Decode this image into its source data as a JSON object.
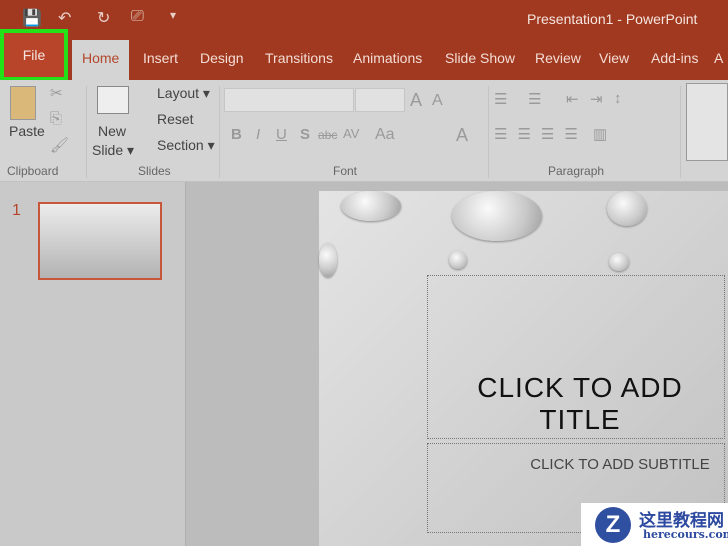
{
  "window": {
    "title": "Presentation1  -  PowerPoint"
  },
  "qat": {
    "save": "💾",
    "undo": "↶",
    "redo": "↻",
    "present": "⎚",
    "customize": "▾"
  },
  "tabs": [
    "File",
    "Home",
    "Insert",
    "Design",
    "Transitions",
    "Animations",
    "Slide Show",
    "Review",
    "View",
    "Add-ins",
    "A"
  ],
  "ribbon": {
    "clipboard": {
      "paste": "Paste",
      "label": "Clipboard"
    },
    "slides": {
      "new_slide": "New",
      "new_slide2": "Slide ▾",
      "layout": "Layout ▾",
      "reset": "Reset",
      "section": "Section ▾",
      "label": "Slides"
    },
    "font": {
      "bold": "B",
      "italic": "I",
      "underline": "U",
      "strike": "S",
      "abc": "abc",
      "spacing": "AV",
      "case": "Aa",
      "grow": "A",
      "shrink": "A",
      "color": "A",
      "label": "Font"
    },
    "paragraph": {
      "label": "Paragraph"
    }
  },
  "thumbnails": [
    {
      "number": "1"
    }
  ],
  "slide": {
    "title_placeholder": "CLICK TO ADD TITLE",
    "subtitle_placeholder": "CLICK TO ADD SUBTITLE"
  },
  "watermark": {
    "cn": "这里教程网",
    "en": "herecours.com",
    "logo": "Z"
  },
  "colors": {
    "accent": "#a0391f",
    "highlight": "#23e318"
  }
}
